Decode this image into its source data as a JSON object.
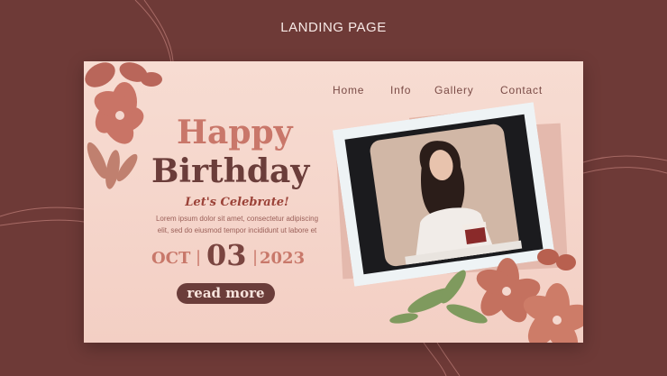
{
  "page_header": "LANDING PAGE",
  "nav": {
    "home": "Home",
    "info": "Info",
    "gallery": "Gallery",
    "contact": "Contact"
  },
  "hero": {
    "title_line1": "Happy",
    "title_line2": "Birthday",
    "subtitle": "Let's Celebrate!",
    "lorem_line1": "Lorem ipsum dolor sit amet, consectetur adipiscing",
    "lorem_line2": "elit, sed do eiusmod tempor incididunt ut labore et"
  },
  "date": {
    "month": "OCT",
    "day": "03",
    "year": "2023",
    "separator": "|"
  },
  "cta": {
    "label": "read more"
  },
  "colors": {
    "background": "#6e3a37",
    "card": "#f5d6cb",
    "accent": "#c9776a",
    "dark": "#6b3d3a"
  }
}
